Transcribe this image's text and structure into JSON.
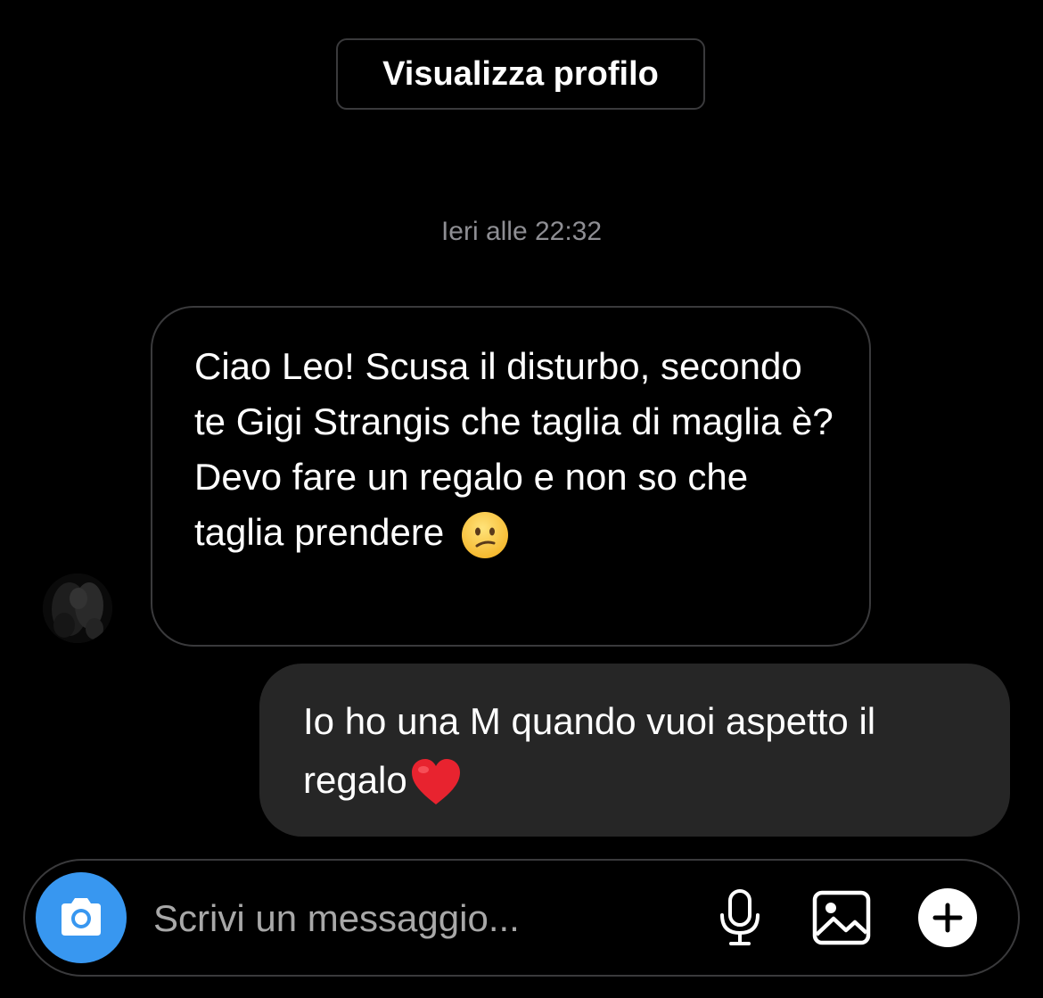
{
  "header": {
    "view_profile_label": "Visualizza profilo"
  },
  "conversation": {
    "timestamp": "Ieri alle 22:32",
    "messages": [
      {
        "direction": "incoming",
        "text": "Ciao Leo! Scusa il disturbo, secondo te Gigi Strangis che taglia di maglia è? Devo fare un regalo e non so che taglia prendere",
        "emoji": "confused-face-emoji"
      },
      {
        "direction": "outgoing",
        "text": "Io ho una M quando vuoi aspetto il regalo",
        "emoji": "red-heart-emoji"
      }
    ]
  },
  "composer": {
    "placeholder": "Scrivi un messaggio...",
    "value": "",
    "icons": [
      "camera-icon",
      "microphone-icon",
      "image-icon",
      "plus-icon"
    ]
  },
  "colors": {
    "background": "#000000",
    "outgoing_bubble": "#262626",
    "border": "#3a3a3c",
    "camera_button": "#3897f0",
    "secondary_text": "#8e8e93"
  }
}
